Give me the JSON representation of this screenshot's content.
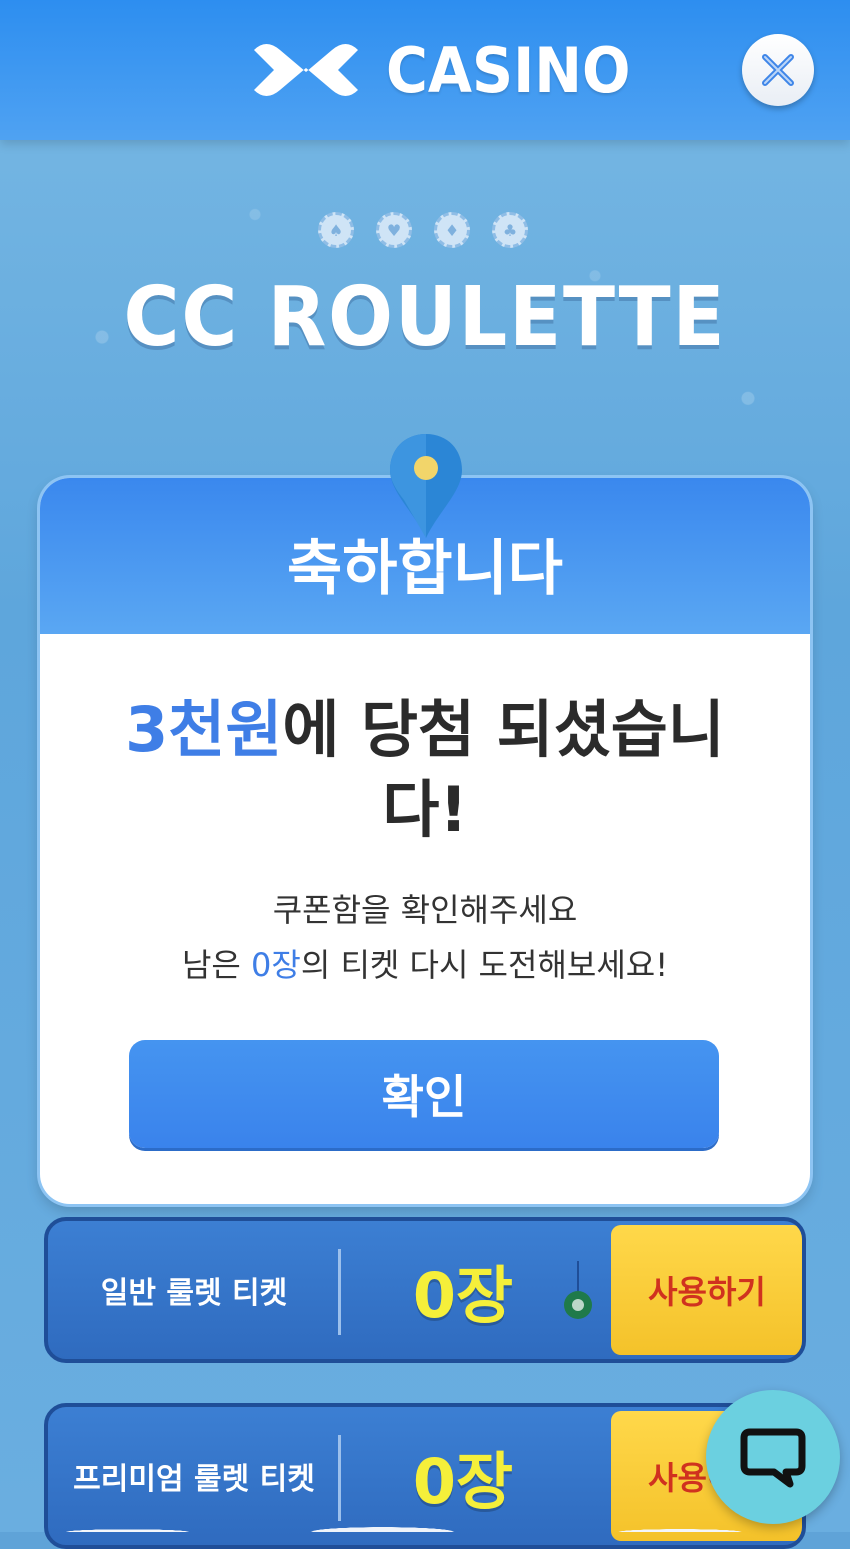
{
  "header": {
    "logo_text": "CASINO",
    "close_icon": "x-icon"
  },
  "game": {
    "title": "CC ROULETTE",
    "chip_icons": [
      "spade-chip-icon",
      "heart-chip-icon",
      "diamond-chip-icon",
      "club-chip-icon"
    ]
  },
  "modal": {
    "title": "축하합니다",
    "prize_amount": "3천원",
    "prize_suffix": "에 당첨 되셨습니다!",
    "message_line1": "쿠폰함을 확인해주세요",
    "message_line2_prefix": "남은 ",
    "message_line2_count": "0장",
    "message_line2_suffix": "의 티켓 다시 도전해보세요!",
    "confirm_label": "확인"
  },
  "tickets": [
    {
      "name": "일반 룰렛 티켓",
      "count": "0장",
      "use_label": "사용하기"
    },
    {
      "name": "프리미엄 룰렛 티켓",
      "count": "0장",
      "use_label": "사용하기"
    }
  ],
  "colors": {
    "accent_blue": "#3f7ee6",
    "ticket_count_yellow": "#f5ef3a",
    "use_button_yellow": "#f4c22a",
    "use_button_text": "#d0321f",
    "chat_button": "#6bd0e0"
  },
  "chat": {
    "icon": "chat-bubble-icon"
  }
}
